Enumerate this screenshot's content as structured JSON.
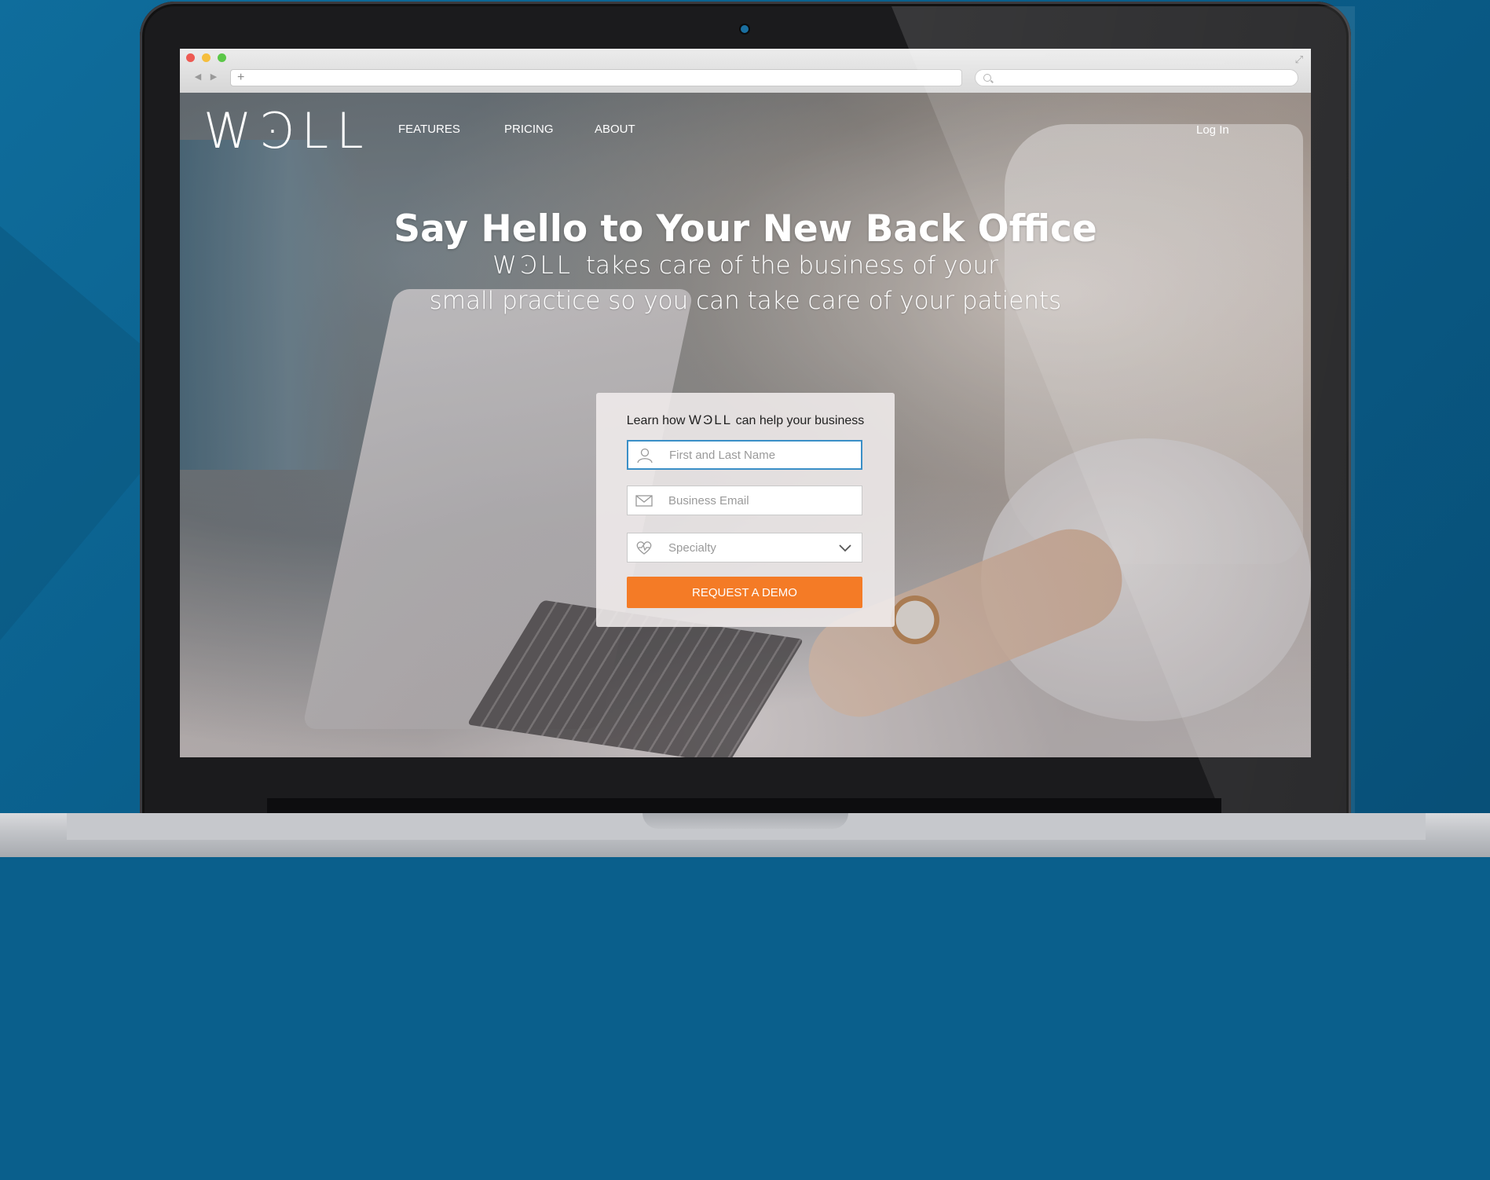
{
  "browser": {
    "back": "◀",
    "forward": "▶",
    "new_tab": "+",
    "expand": "⤢"
  },
  "site": {
    "logo": "WϿLL",
    "nav": [
      "FEATURES",
      "PRICING",
      "ABOUT"
    ],
    "login": "Log In"
  },
  "hero": {
    "headline": "Say Hello to Your New Back Office",
    "sub_logo": "WϿLL",
    "sub_line1_rest": "takes care of the business of your",
    "sub_line2": "small practice so you can take care of your patients"
  },
  "form": {
    "title_pre": "Learn how",
    "title_logo": "WϿLL",
    "title_post": "can help your business",
    "name_placeholder": "First and Last Name",
    "email_placeholder": "Business Email",
    "specialty_placeholder": "Specialty",
    "cta": "REQUEST A DEMO"
  },
  "colors": {
    "accent": "#f47b26",
    "focus": "#3a8fc7",
    "background": "#0a5f8c"
  }
}
